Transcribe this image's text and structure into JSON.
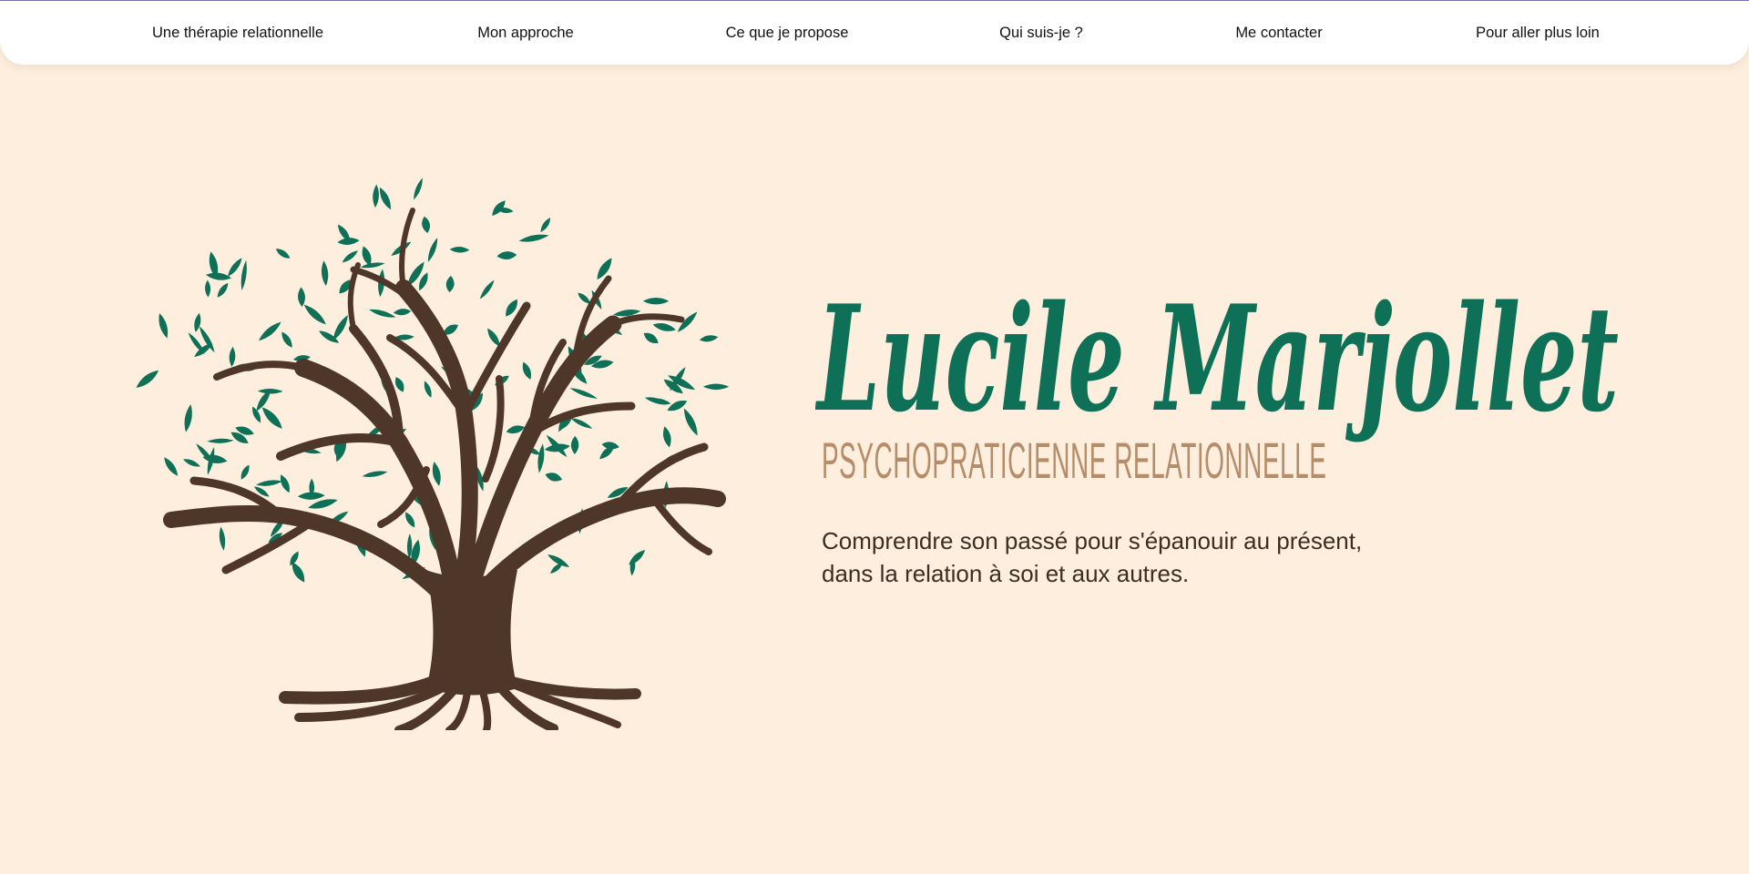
{
  "nav": {
    "items": [
      {
        "label": "Une thérapie relationnelle"
      },
      {
        "label": "Mon approche"
      },
      {
        "label": "Ce que je propose"
      },
      {
        "label": "Qui suis-je ?"
      },
      {
        "label": "Me contacter"
      },
      {
        "label": "Pour aller plus loin"
      }
    ]
  },
  "hero": {
    "name": "Lucile Marjollet",
    "subtitle": "PSYCHOPRATICIENNE RELATIONNELLE",
    "tagline_line1": "Comprendre son passé pour s'épanouir au présent,",
    "tagline_line2": "dans la relation à soi et aux autres.",
    "logo_icon": "tree-of-life-icon"
  },
  "colors": {
    "background": "#fdeedd",
    "nav_background": "#ffffff",
    "name_green": "#0e7057",
    "leaf_green": "#0e7057",
    "trunk_brown": "#4e3628",
    "subtitle_tan": "#b58d6b",
    "tagline_text": "#3d2e22"
  }
}
